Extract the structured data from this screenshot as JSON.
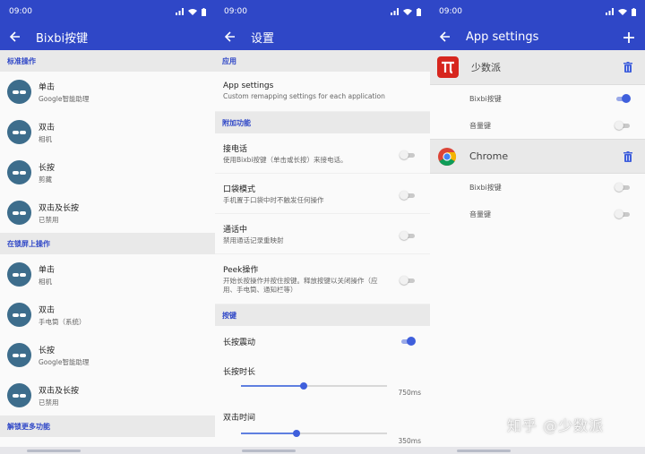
{
  "statusbar": {
    "time": "09:00"
  },
  "panel1": {
    "title": "Bixbi按键",
    "section1": "标准操作",
    "items1": [
      {
        "title": "单击",
        "subtitle": "Google智能助理"
      },
      {
        "title": "双击",
        "subtitle": "相机"
      },
      {
        "title": "长按",
        "subtitle": "剪藏"
      },
      {
        "title": "双击及长按",
        "subtitle": "已禁用"
      }
    ],
    "section2": "在锁屏上操作",
    "items2": [
      {
        "title": "单击",
        "subtitle": "相机"
      },
      {
        "title": "双击",
        "subtitle": "手电筒（系统）"
      },
      {
        "title": "长按",
        "subtitle": "Google智能助理"
      },
      {
        "title": "双击及长按",
        "subtitle": "已禁用"
      }
    ],
    "section3": "解锁更多功能"
  },
  "panel2": {
    "title": "设置",
    "section_app": "应用",
    "app_settings": {
      "title": "App settings",
      "subtitle": "Custom remapping settings for each application"
    },
    "section_extra": "附加功能",
    "extras": [
      {
        "title": "接电话",
        "subtitle": "使用Bixbi按键（单击或长按）来接电话。",
        "on": false
      },
      {
        "title": "口袋模式",
        "subtitle": "手机置于口袋中时不触发任何操作",
        "on": false
      },
      {
        "title": "通话中",
        "subtitle": "禁用通话记录重映射",
        "on": false
      },
      {
        "title": "Peek操作",
        "subtitle": "开始长按操作并按住按键。释放按键以关闭操作（应用、手电筒、通知栏等）",
        "on": false
      }
    ],
    "section_keys": "按键",
    "long_press_vibrate": {
      "title": "长按震动",
      "on": true
    },
    "long_press_time": {
      "title": "长按时长",
      "value": "750ms",
      "fraction": 0.43
    },
    "double_click_time": {
      "title": "双击时间",
      "value": "350ms",
      "fraction": 0.38
    }
  },
  "panel3": {
    "title": "App settings",
    "apps": [
      {
        "name": "少数派",
        "rows": [
          {
            "label": "Bixbi按键",
            "on": true
          },
          {
            "label": "音量键",
            "on": false
          }
        ]
      },
      {
        "name": "Chrome",
        "rows": [
          {
            "label": "Bixbi按键",
            "on": false
          },
          {
            "label": "音量键",
            "on": false
          }
        ]
      }
    ]
  },
  "colors": {
    "primary": "#2f47c7",
    "accent": "#3f5fdc",
    "avatar": "#3d6d8c",
    "sspai_red": "#d7261e"
  },
  "watermark": "知乎 @少数派"
}
